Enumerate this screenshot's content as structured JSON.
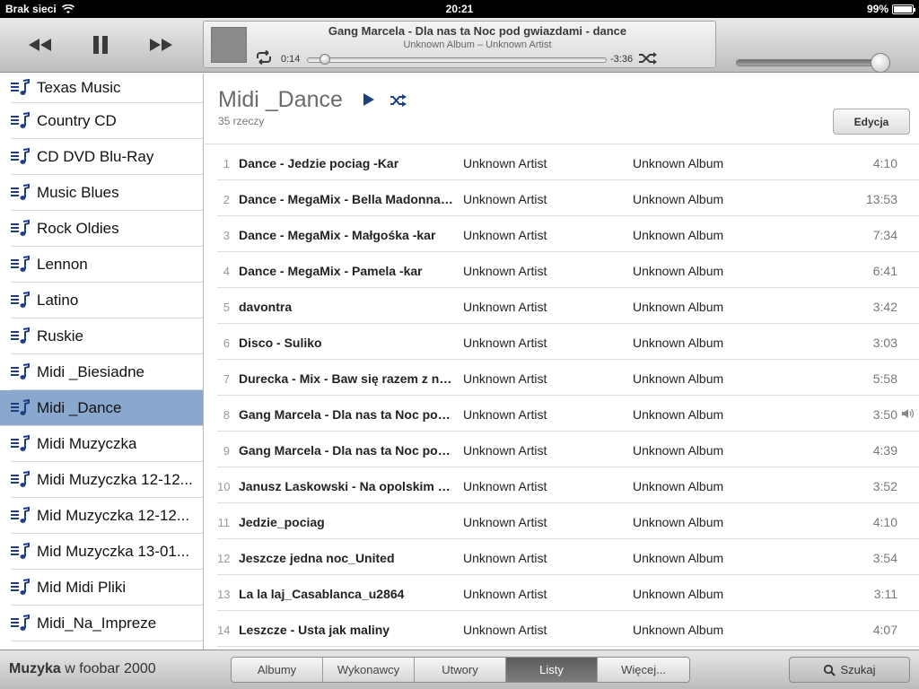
{
  "status": {
    "carrier": "Brak sieci",
    "time": "20:21",
    "battery": "99%",
    "battery_level": 0.99
  },
  "now_playing": {
    "title": "Gang Marcela - Dla nas ta Noc pod gwiazdami - dance",
    "subtitle": "Unknown Album – Unknown Artist",
    "elapsed": "0:14",
    "remaining": "-3:36",
    "progress": 0.06
  },
  "volume_level": 0.94,
  "sidebar": {
    "items": [
      {
        "label": "Texas Music"
      },
      {
        "label": "Country CD"
      },
      {
        "label": "CD DVD Blu-Ray"
      },
      {
        "label": "Music Blues"
      },
      {
        "label": "Rock Oldies"
      },
      {
        "label": "Lennon"
      },
      {
        "label": "Latino"
      },
      {
        "label": "Ruskie"
      },
      {
        "label": "Midi _Biesiadne"
      },
      {
        "label": "Midi _Dance",
        "selected": true
      },
      {
        "label": "Midi Muzyczka"
      },
      {
        "label": "Midi Muzyczka 12-12..."
      },
      {
        "label": "Mid Muzyczka 12-12..."
      },
      {
        "label": "Mid Muzyczka 13-01..."
      },
      {
        "label": "Mid Midi Pliki"
      },
      {
        "label": "Midi_Na_Impreze"
      }
    ]
  },
  "playlist": {
    "title": "Midi _Dance",
    "count": "35 rzeczy",
    "edit_label": "Edycja",
    "rows": [
      {
        "n": "1",
        "name": "Dance - Jedzie pociag -Kar",
        "artist": "Unknown Artist",
        "album": "Unknown Album",
        "duration": "4:10"
      },
      {
        "n": "2",
        "name": "Dance - MegaMix - Bella Madonna -kar",
        "artist": "Unknown Artist",
        "album": "Unknown Album",
        "duration": "13:53"
      },
      {
        "n": "3",
        "name": "Dance - MegaMix - Małgośka -kar",
        "artist": "Unknown Artist",
        "album": "Unknown Album",
        "duration": "7:34"
      },
      {
        "n": "4",
        "name": "Dance - MegaMix - Pamela -kar",
        "artist": "Unknown Artist",
        "album": "Unknown Album",
        "duration": "6:41"
      },
      {
        "n": "5",
        "name": "davontra",
        "artist": "Unknown Artist",
        "album": "Unknown Album",
        "duration": "3:42"
      },
      {
        "n": "6",
        "name": "Disco - Suliko",
        "artist": "Unknown Artist",
        "album": "Unknown Album",
        "duration": "3:03"
      },
      {
        "n": "7",
        "name": "Durecka - Mix - Baw się razem z nami",
        "artist": "Unknown Artist",
        "album": "Unknown Album",
        "duration": "5:58"
      },
      {
        "n": "8",
        "name": "Gang Marcela - Dla nas ta Noc pod gwiazdami",
        "artist": "Unknown Artist",
        "album": "Unknown Album",
        "duration": "3:50",
        "playing": true
      },
      {
        "n": "9",
        "name": "Gang Marcela - Dla nas ta Noc pod gwiazdami",
        "artist": "Unknown Artist",
        "album": "Unknown Album",
        "duration": "4:39"
      },
      {
        "n": "10",
        "name": "Janusz Laskowski - Na opolskim rynku",
        "artist": "Unknown Artist",
        "album": "Unknown Album",
        "duration": "3:52"
      },
      {
        "n": "11",
        "name": "Jedzie_pociag",
        "artist": "Unknown Artist",
        "album": "Unknown Album",
        "duration": "4:10"
      },
      {
        "n": "12",
        "name": "Jeszcze jedna noc_United",
        "artist": "Unknown Artist",
        "album": "Unknown Album",
        "duration": "3:54"
      },
      {
        "n": "13",
        "name": "La la laj_Casablanca_u2864",
        "artist": "Unknown Artist",
        "album": "Unknown Album",
        "duration": "3:11"
      },
      {
        "n": "14",
        "name": "Leszcze - Usta jak maliny",
        "artist": "Unknown Artist",
        "album": "Unknown Album",
        "duration": "4:07"
      }
    ]
  },
  "bottom": {
    "library_bold": "Muzyka",
    "library_rest": " w foobar 2000",
    "tabs": [
      {
        "label": "Albumy"
      },
      {
        "label": "Wykonawcy"
      },
      {
        "label": "Utwory"
      },
      {
        "label": "Listy",
        "active": true
      },
      {
        "label": "Więcej..."
      }
    ],
    "search_label": "Szukaj"
  },
  "colors": {
    "selection": "#8aa7cd",
    "accent_icon": "#1d3f80"
  }
}
